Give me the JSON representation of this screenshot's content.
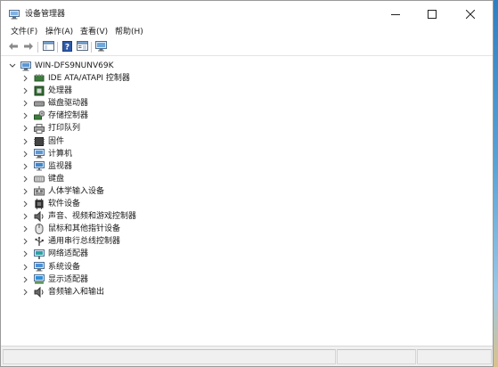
{
  "window": {
    "title": "设备管理器"
  },
  "menu": [
    "文件(F)",
    "操作(A)",
    "查看(V)",
    "帮助(H)"
  ],
  "toolbar_icons": [
    "back-arrow-icon",
    "forward-arrow-icon",
    "show-hide-console-tree-icon",
    "help-icon",
    "properties-icon",
    "scan-hardware-icon"
  ],
  "tree": {
    "root": "WIN-DFS9NUNV69K",
    "items": [
      {
        "label": "IDE ATA/ATAPI 控制器",
        "icon": "ide-controller-icon"
      },
      {
        "label": "处理器",
        "icon": "processor-icon"
      },
      {
        "label": "磁盘驱动器",
        "icon": "disk-drive-icon"
      },
      {
        "label": "存储控制器",
        "icon": "storage-controller-icon"
      },
      {
        "label": "打印队列",
        "icon": "printer-icon"
      },
      {
        "label": "固件",
        "icon": "firmware-icon"
      },
      {
        "label": "计算机",
        "icon": "computer-icon"
      },
      {
        "label": "监视器",
        "icon": "monitor-icon"
      },
      {
        "label": "键盘",
        "icon": "keyboard-icon"
      },
      {
        "label": "人体学输入设备",
        "icon": "hid-icon"
      },
      {
        "label": "软件设备",
        "icon": "software-device-icon"
      },
      {
        "label": "声音、视频和游戏控制器",
        "icon": "sound-icon"
      },
      {
        "label": "鼠标和其他指针设备",
        "icon": "mouse-icon"
      },
      {
        "label": "通用串行总线控制器",
        "icon": "usb-icon"
      },
      {
        "label": "网络适配器",
        "icon": "network-adapter-icon"
      },
      {
        "label": "系统设备",
        "icon": "system-device-icon"
      },
      {
        "label": "显示适配器",
        "icon": "display-adapter-icon"
      },
      {
        "label": "音频输入和输出",
        "icon": "audio-io-icon"
      }
    ]
  },
  "colors": {
    "accent": "#2b79c9",
    "selection": "#cce8ff"
  }
}
